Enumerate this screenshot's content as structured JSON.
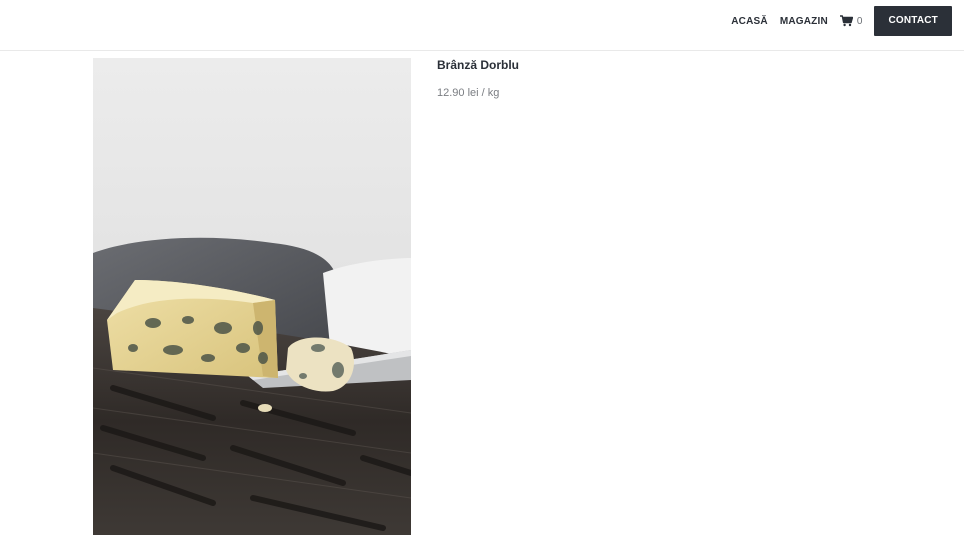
{
  "header": {
    "nav": [
      {
        "label": "ACASĂ"
      },
      {
        "label": "MAGAZIN"
      }
    ],
    "cart": {
      "icon": "cart-icon",
      "count": "0"
    },
    "contact_label": "CONTACT"
  },
  "product": {
    "title": "Brânză Dorblu",
    "price": "12.90 lei / kg",
    "image": "blue-cheese-wedge-on-wooden-board"
  }
}
